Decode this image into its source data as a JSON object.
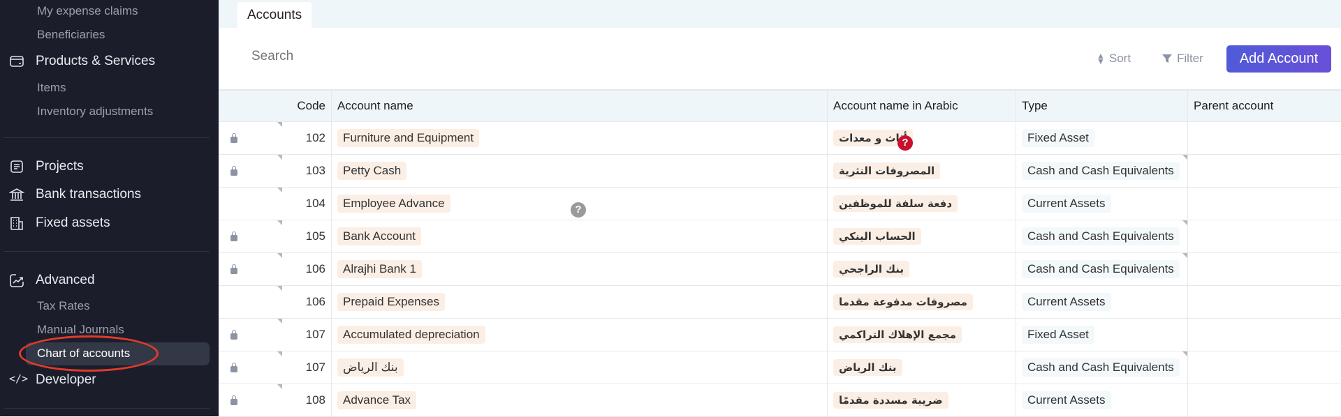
{
  "sidebar": {
    "items": [
      {
        "label": "My expense claims",
        "type": "sub"
      },
      {
        "label": "Beneficiaries",
        "type": "sub"
      },
      {
        "label": "Products & Services",
        "type": "main",
        "icon": "wallet-icon"
      },
      {
        "label": "Items",
        "type": "sub"
      },
      {
        "label": "Inventory adjustments",
        "type": "sub"
      },
      {
        "label": "Projects",
        "type": "main",
        "icon": "document-icon"
      },
      {
        "label": "Bank transactions",
        "type": "main",
        "icon": "bank-icon"
      },
      {
        "label": "Fixed assets",
        "type": "main",
        "icon": "building-icon"
      },
      {
        "label": "Advanced",
        "type": "main",
        "icon": "chart-icon"
      },
      {
        "label": "Tax Rates",
        "type": "sub"
      },
      {
        "label": "Manual Journals",
        "type": "sub"
      },
      {
        "label": "Chart of accounts",
        "type": "sub",
        "active": true
      },
      {
        "label": "Developer",
        "type": "main",
        "icon": "code-icon"
      }
    ]
  },
  "tabs": {
    "active": "Accounts"
  },
  "toolbar": {
    "search_placeholder": "Search",
    "sort": "Sort",
    "filter": "Filter",
    "add": "Add Account"
  },
  "table": {
    "headers": [
      "Code",
      "Account name",
      "Account name in Arabic",
      "Type",
      "Parent account"
    ],
    "rows": [
      {
        "locked": true,
        "code": "102",
        "name": "Furniture and Equipment",
        "arabic": "أثاث و معدات",
        "type": "Fixed Asset",
        "parent": ""
      },
      {
        "locked": true,
        "code": "103",
        "name": "Petty Cash",
        "arabic": "المصروفات النثرية",
        "type": "Cash and Cash Equivalents",
        "parent": ""
      },
      {
        "locked": false,
        "code": "104",
        "name": "Employee Advance",
        "arabic": "دفعة سلفة للموظفين",
        "type": "Current Assets",
        "parent": ""
      },
      {
        "locked": true,
        "code": "105",
        "name": "Bank Account",
        "arabic": "الحساب البنكي",
        "type": "Cash and Cash Equivalents",
        "parent": ""
      },
      {
        "locked": true,
        "code": "106",
        "name": "Alrajhi Bank 1",
        "arabic": "بنك الراجحي",
        "type": "Cash and Cash Equivalents",
        "parent": ""
      },
      {
        "locked": false,
        "code": "106",
        "name": "Prepaid Expenses",
        "arabic": "مصروفات مدفوعة مقدما",
        "type": "Current Assets",
        "parent": ""
      },
      {
        "locked": true,
        "code": "107",
        "name": "Accumulated depreciation",
        "arabic": "مجمع الإهلاك التراكمي",
        "type": "Fixed Asset",
        "parent": ""
      },
      {
        "locked": true,
        "code": "107",
        "name": "بنك الرياض",
        "arabic": "بنك الرياض",
        "type": "Cash and Cash Equivalents",
        "parent": ""
      },
      {
        "locked": true,
        "code": "108",
        "name": "Advance Tax",
        "arabic": "ضريبة مسددة مقدمًا",
        "type": "Current Assets",
        "parent": ""
      }
    ]
  },
  "help_marks": [
    "?",
    "?"
  ],
  "colors": {
    "sidebar": "#1b1e2a",
    "accent": "#5558d9",
    "annotation": "#e23a2c"
  }
}
